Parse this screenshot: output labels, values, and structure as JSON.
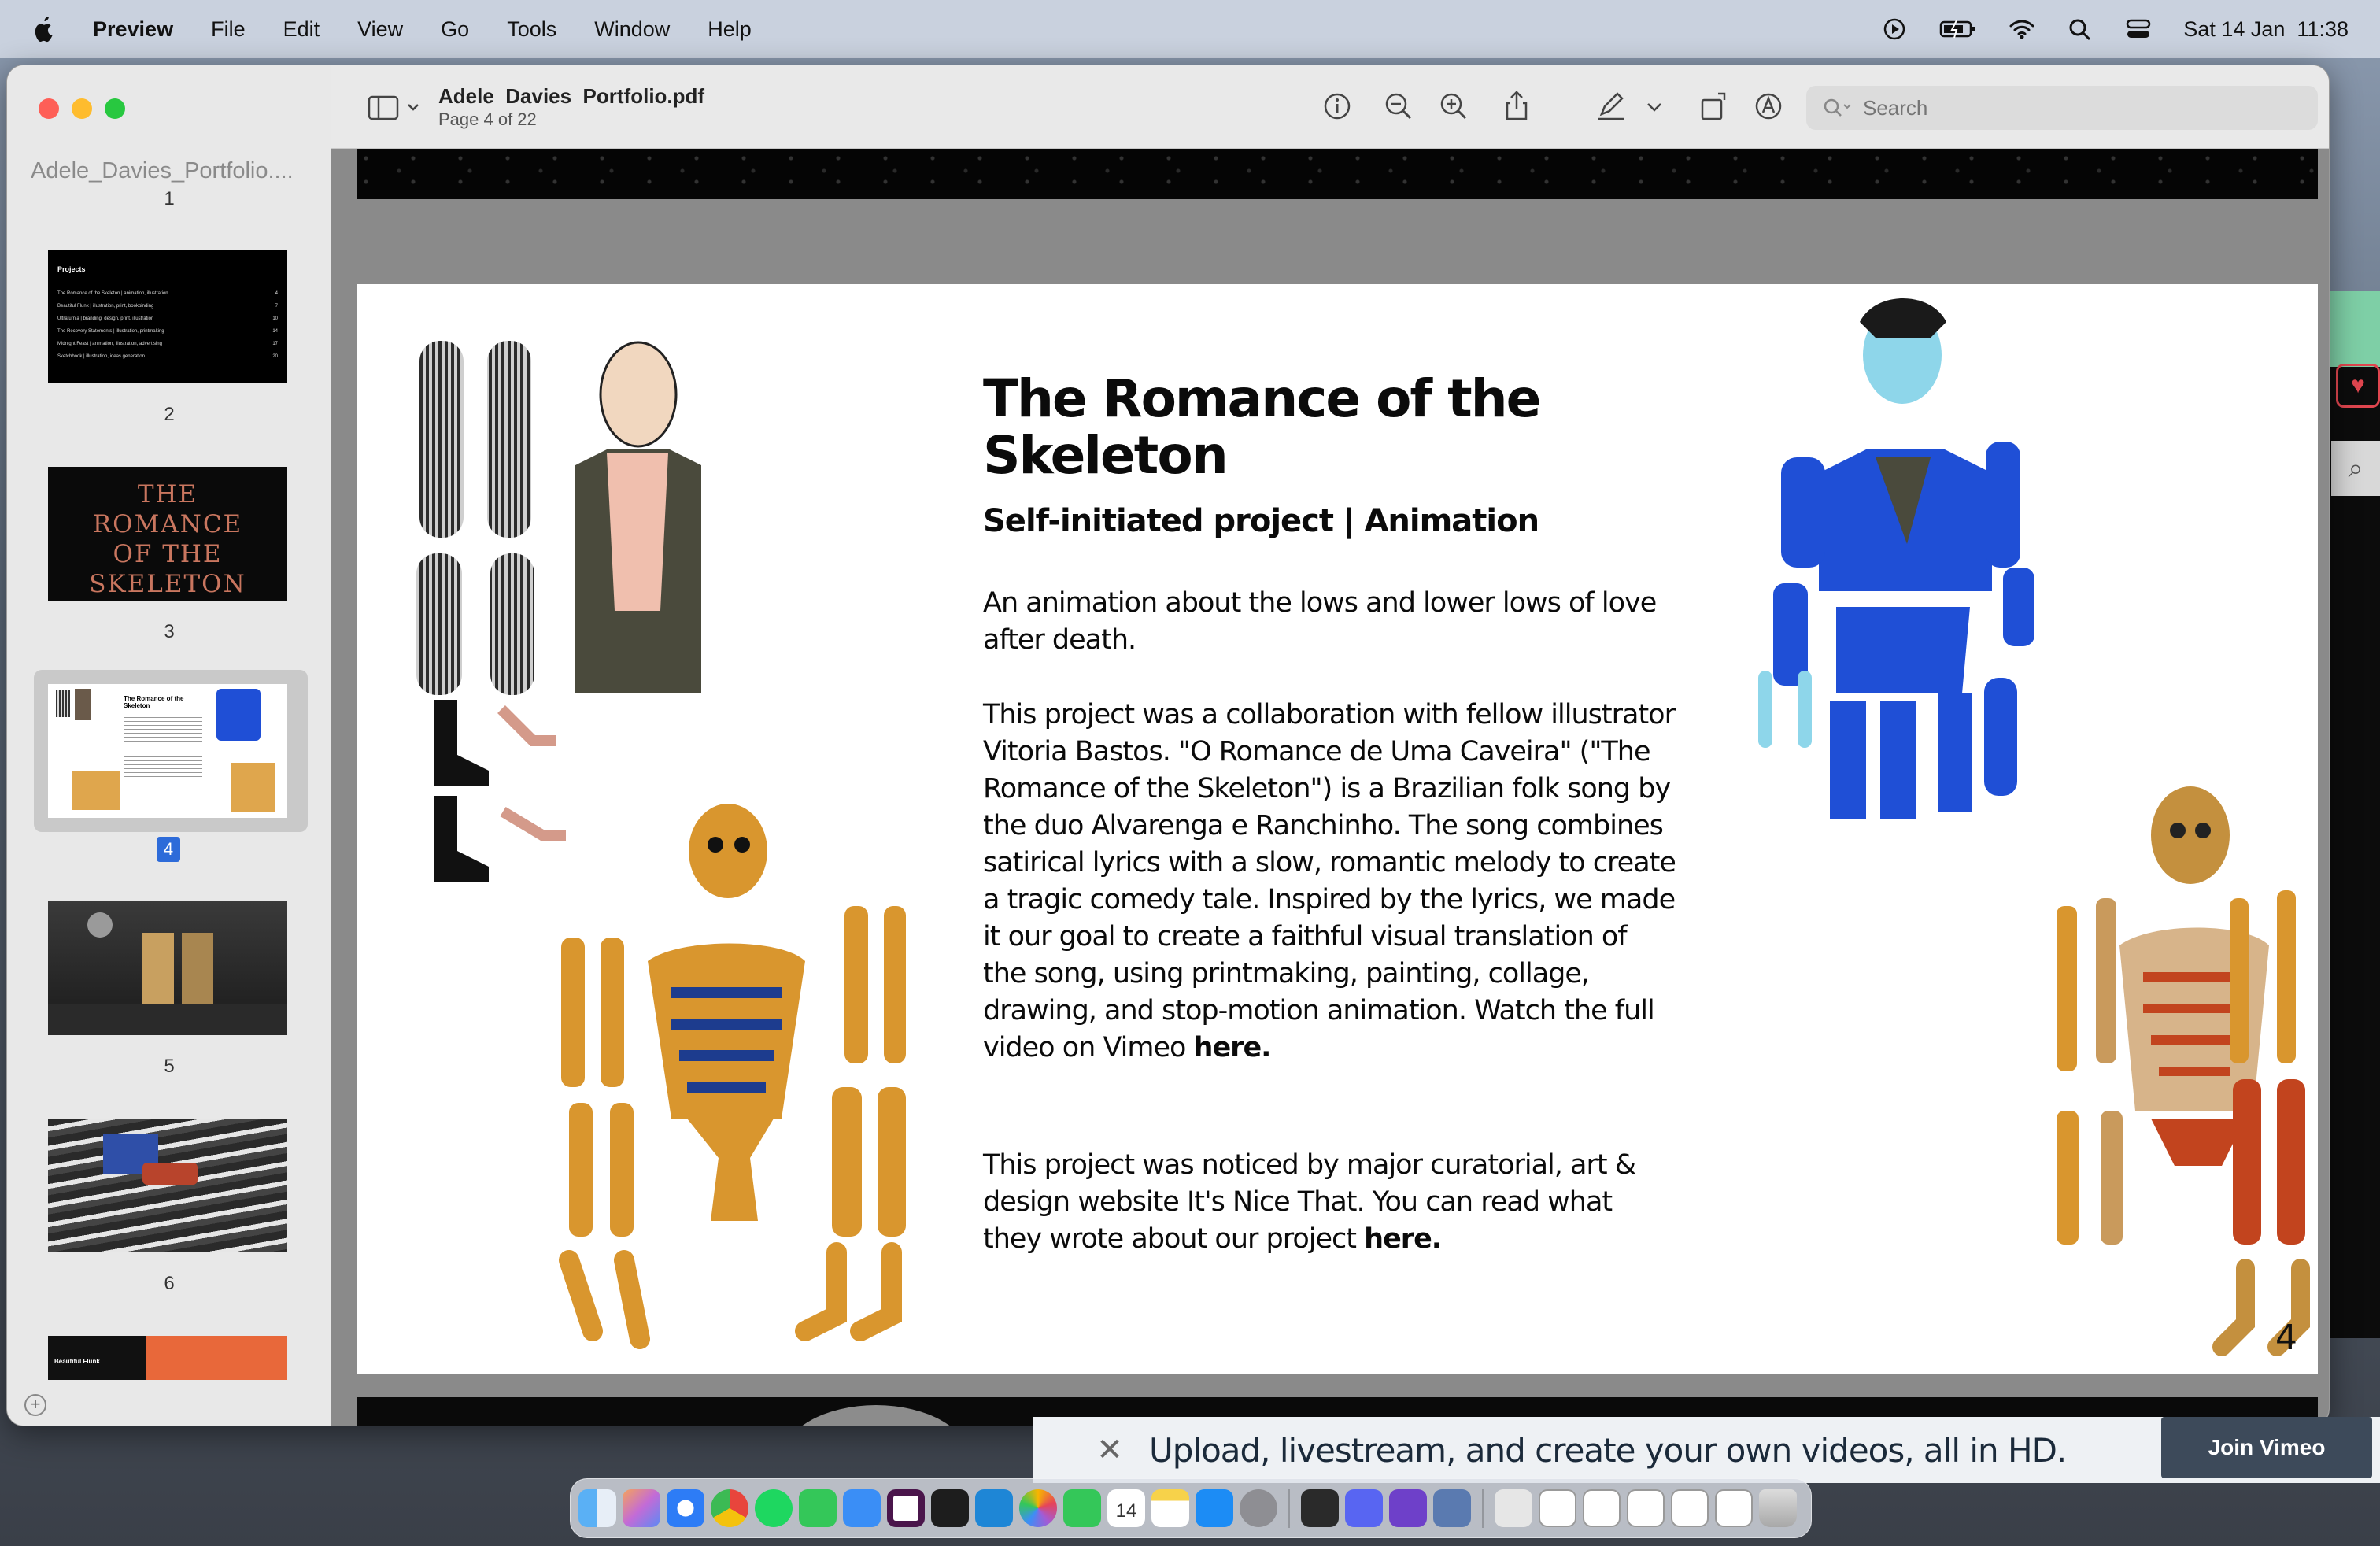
{
  "menubar": {
    "app_name": "Preview",
    "items": [
      "File",
      "Edit",
      "View",
      "Go",
      "Tools",
      "Window",
      "Help"
    ],
    "datetime": "Sat 14 Jan  11:38"
  },
  "window": {
    "doc_title": "Adele_Davies_Portfolio.pdf",
    "page_indicator": "Page 4 of 22",
    "search_placeholder": "Search",
    "sidebar_title": "Adele_Davies_Portfolio....",
    "thumbnails": [
      {
        "page": "1"
      },
      {
        "page": "2",
        "heading": "Projects",
        "rows": [
          "The Romance of the Skeleton | animation, illustration",
          "Beautiful Flunk | illustration, print, bookbinding",
          "Ultraturnia | branding, design, print, illustration",
          "The Recovery Statements | illustration, printmaking",
          "Midnight Feast | animation, illustration, advertising",
          "Sketchbook | illustration, ideas generation"
        ],
        "nums": [
          "4",
          "7",
          "10",
          "14",
          "17",
          "20"
        ]
      },
      {
        "page": "3",
        "lettering": "THE ROMANCE OF THE SKELETON"
      },
      {
        "page": "4",
        "selected": true
      },
      {
        "page": "5"
      },
      {
        "page": "6"
      },
      {
        "page": "7",
        "heading": "Beautiful Flunk"
      }
    ]
  },
  "page4": {
    "title": "The Romance of the Skeleton",
    "subtitle": "Self-initiated project | Animation",
    "para1": "An animation about the lows and lower lows of love after death.",
    "para2": "This project was a collaboration with fellow illustrator Vitoria Bastos. \"O Romance de Uma Caveira\" (\"The Romance of the Skeleton\") is a Brazilian folk song by the duo Alvarenga e Ranchinho. The song combines satirical lyrics with a slow, romantic melody to create a tragic comedy tale. Inspired by the lyrics, we made it our goal to create a faithful visual translation of the song, using printmaking, painting, collage, drawing, and stop-motion animation. Watch the full video on Vimeo",
    "para2_link": "here.",
    "para3": "This project was noticed by major curatorial, art & design website It's Nice That. You can read what they wrote about our project",
    "para3_link": "here.",
    "page_number": "4"
  },
  "vimeo": {
    "close": "✕",
    "text": "Upload, livestream, and create your own videos, all in HD.",
    "button": "Join Vimeo"
  },
  "dock": {
    "calendar_day": "14",
    "apps": [
      "Finder",
      "Launchpad",
      "Safari",
      "Chrome",
      "Spotify",
      "Messages",
      "Mail",
      "Slack",
      "Terminal",
      "VS Code",
      "Photos",
      "FaceTime",
      "Calendar",
      "Notes",
      "App Store",
      "System Settings",
      "Preview",
      "Discord",
      "GitHub Desktop",
      "Screenshot",
      "Downloads",
      "Trash"
    ]
  },
  "colors": {
    "accent": "#2d6bd9",
    "skeleton_ochre": "#d9962e",
    "figure_blue": "#1f4fd6"
  }
}
